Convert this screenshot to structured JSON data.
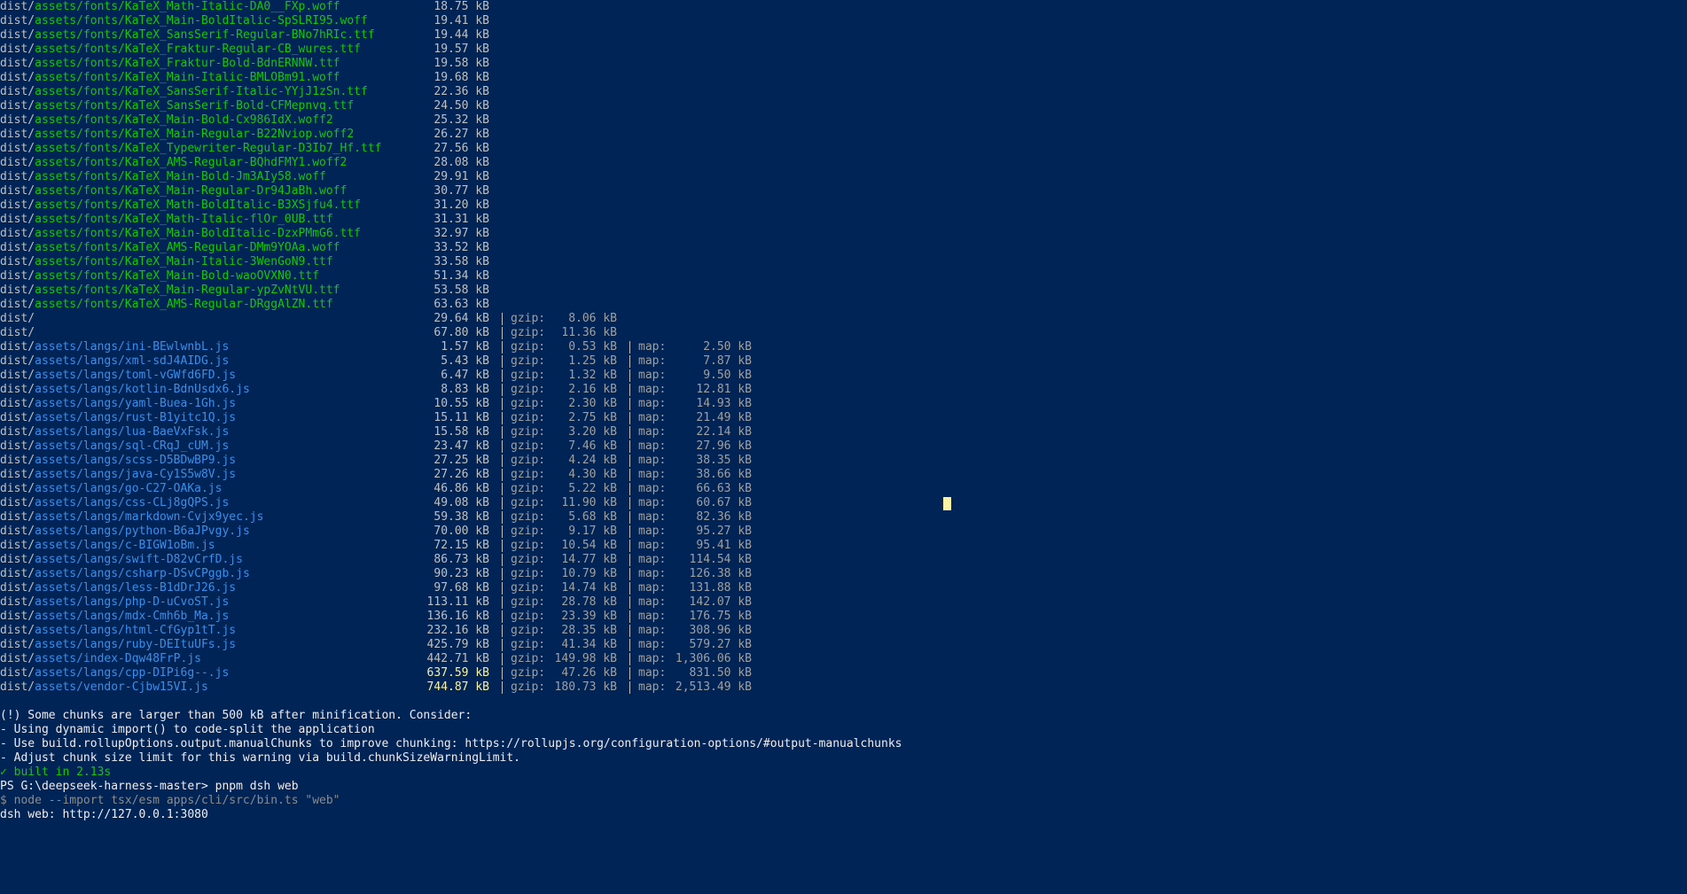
{
  "terminal": {
    "background": "#012456",
    "colors": {
      "font_asset": "#16c60c",
      "lang_asset": "#3b8eea",
      "text": "#c0c0c0",
      "large_chunk": "#f9f1a5",
      "success": "#16c60c",
      "cursor": "#f9f1a5"
    },
    "font_rows": [
      {
        "prefix": "dist/",
        "path": "assets/fonts/KaTeX_Math-Italic-DA0__FXp.woff",
        "size": "18.75 kB"
      },
      {
        "prefix": "dist/",
        "path": "assets/fonts/KaTeX_Main-BoldItalic-SpSLRI95.woff",
        "size": "19.41 kB"
      },
      {
        "prefix": "dist/",
        "path": "assets/fonts/KaTeX_SansSerif-Regular-BNo7hRIc.ttf",
        "size": "19.44 kB"
      },
      {
        "prefix": "dist/",
        "path": "assets/fonts/KaTeX_Fraktur-Regular-CB_wures.ttf",
        "size": "19.57 kB"
      },
      {
        "prefix": "dist/",
        "path": "assets/fonts/KaTeX_Fraktur-Bold-BdnERNNW.ttf",
        "size": "19.58 kB"
      },
      {
        "prefix": "dist/",
        "path": "assets/fonts/KaTeX_Main-Italic-BMLOBm91.woff",
        "size": "19.68 kB"
      },
      {
        "prefix": "dist/",
        "path": "assets/fonts/KaTeX_SansSerif-Italic-YYjJ1zSn.ttf",
        "size": "22.36 kB"
      },
      {
        "prefix": "dist/",
        "path": "assets/fonts/KaTeX_SansSerif-Bold-CFMepnvq.ttf",
        "size": "24.50 kB"
      },
      {
        "prefix": "dist/",
        "path": "assets/fonts/KaTeX_Main-Bold-Cx986IdX.woff2",
        "size": "25.32 kB"
      },
      {
        "prefix": "dist/",
        "path": "assets/fonts/KaTeX_Main-Regular-B22Nviop.woff2",
        "size": "26.27 kB"
      },
      {
        "prefix": "dist/",
        "path": "assets/fonts/KaTeX_Typewriter-Regular-D3Ib7_Hf.ttf",
        "size": "27.56 kB"
      },
      {
        "prefix": "dist/",
        "path": "assets/fonts/KaTeX_AMS-Regular-BQhdFMY1.woff2",
        "size": "28.08 kB"
      },
      {
        "prefix": "dist/",
        "path": "assets/fonts/KaTeX_Main-Bold-Jm3AIy58.woff",
        "size": "29.91 kB"
      },
      {
        "prefix": "dist/",
        "path": "assets/fonts/KaTeX_Main-Regular-Dr94JaBh.woff",
        "size": "30.77 kB"
      },
      {
        "prefix": "dist/",
        "path": "assets/fonts/KaTeX_Math-BoldItalic-B3XSjfu4.ttf",
        "size": "31.20 kB"
      },
      {
        "prefix": "dist/",
        "path": "assets/fonts/KaTeX_Math-Italic-flOr_0UB.ttf",
        "size": "31.31 kB"
      },
      {
        "prefix": "dist/",
        "path": "assets/fonts/KaTeX_Main-BoldItalic-DzxPMmG6.ttf",
        "size": "32.97 kB"
      },
      {
        "prefix": "dist/",
        "path": "assets/fonts/KaTeX_AMS-Regular-DMm9YOAa.woff",
        "size": "33.52 kB"
      },
      {
        "prefix": "dist/",
        "path": "assets/fonts/KaTeX_Main-Italic-3WenGoN9.ttf",
        "size": "33.58 kB"
      },
      {
        "prefix": "dist/",
        "path": "assets/fonts/KaTeX_Main-Bold-waoOVXN0.ttf",
        "size": "51.34 kB"
      },
      {
        "prefix": "dist/",
        "path": "assets/fonts/KaTeX_Main-Regular-ypZvNtVU.ttf",
        "size": "53.58 kB"
      },
      {
        "prefix": "dist/",
        "path": "assets/fonts/KaTeX_AMS-Regular-DRggAlZN.ttf",
        "size": "63.63 kB"
      }
    ],
    "dist_rows": [
      {
        "path": "dist/",
        "size": "29.64 kB",
        "gzip_label": "gzip:",
        "gzip": "8.06 kB"
      },
      {
        "path": "dist/",
        "size": "67.80 kB",
        "gzip_label": "gzip:",
        "gzip": "11.36 kB"
      }
    ],
    "lang_rows": [
      {
        "prefix": "dist/",
        "path": "assets/langs/ini-BEwlwnbL.js",
        "size": "1.57 kB",
        "gzip": "0.53 kB",
        "map": "2.50 kB"
      },
      {
        "prefix": "dist/",
        "path": "assets/langs/xml-sdJ4AIDG.js",
        "size": "5.43 kB",
        "gzip": "1.25 kB",
        "map": "7.87 kB"
      },
      {
        "prefix": "dist/",
        "path": "assets/langs/toml-vGWfd6FD.js",
        "size": "6.47 kB",
        "gzip": "1.32 kB",
        "map": "9.50 kB"
      },
      {
        "prefix": "dist/",
        "path": "assets/langs/kotlin-BdnUsdx6.js",
        "size": "8.83 kB",
        "gzip": "2.16 kB",
        "map": "12.81 kB"
      },
      {
        "prefix": "dist/",
        "path": "assets/langs/yaml-Buea-1Gh.js",
        "size": "10.55 kB",
        "gzip": "2.30 kB",
        "map": "14.93 kB"
      },
      {
        "prefix": "dist/",
        "path": "assets/langs/rust-B1yitc1Q.js",
        "size": "15.11 kB",
        "gzip": "2.75 kB",
        "map": "21.49 kB"
      },
      {
        "prefix": "dist/",
        "path": "assets/langs/lua-BaeVxFsk.js",
        "size": "15.58 kB",
        "gzip": "3.20 kB",
        "map": "22.14 kB"
      },
      {
        "prefix": "dist/",
        "path": "assets/langs/sql-CRqJ_cUM.js",
        "size": "23.47 kB",
        "gzip": "7.46 kB",
        "map": "27.96 kB"
      },
      {
        "prefix": "dist/",
        "path": "assets/langs/scss-D5BDwBP9.js",
        "size": "27.25 kB",
        "gzip": "4.24 kB",
        "map": "38.35 kB"
      },
      {
        "prefix": "dist/",
        "path": "assets/langs/java-Cy1S5w8V.js",
        "size": "27.26 kB",
        "gzip": "4.30 kB",
        "map": "38.66 kB"
      },
      {
        "prefix": "dist/",
        "path": "assets/langs/go-C27-OAKa.js",
        "size": "46.86 kB",
        "gzip": "5.22 kB",
        "map": "66.63 kB"
      },
      {
        "prefix": "dist/",
        "path": "assets/langs/css-CLj8gQPS.js",
        "size": "49.08 kB",
        "gzip": "11.90 kB",
        "map": "60.67 kB"
      },
      {
        "prefix": "dist/",
        "path": "assets/langs/markdown-Cvjx9yec.js",
        "size": "59.38 kB",
        "gzip": "5.68 kB",
        "map": "82.36 kB"
      },
      {
        "prefix": "dist/",
        "path": "assets/langs/python-B6aJPvgy.js",
        "size": "70.00 kB",
        "gzip": "9.17 kB",
        "map": "95.27 kB"
      },
      {
        "prefix": "dist/",
        "path": "assets/langs/c-BIGW1oBm.js",
        "size": "72.15 kB",
        "gzip": "10.54 kB",
        "map": "95.41 kB"
      },
      {
        "prefix": "dist/",
        "path": "assets/langs/swift-D82vCrfD.js",
        "size": "86.73 kB",
        "gzip": "14.77 kB",
        "map": "114.54 kB"
      },
      {
        "prefix": "dist/",
        "path": "assets/langs/csharp-DSvCPggb.js",
        "size": "90.23 kB",
        "gzip": "10.79 kB",
        "map": "126.38 kB"
      },
      {
        "prefix": "dist/",
        "path": "assets/langs/less-B1dDrJ26.js",
        "size": "97.68 kB",
        "gzip": "14.74 kB",
        "map": "131.88 kB"
      },
      {
        "prefix": "dist/",
        "path": "assets/langs/php-D-uCvoST.js",
        "size": "113.11 kB",
        "gzip": "28.78 kB",
        "map": "142.07 kB"
      },
      {
        "prefix": "dist/",
        "path": "assets/langs/mdx-Cmh6b_Ma.js",
        "size": "136.16 kB",
        "gzip": "23.39 kB",
        "map": "176.75 kB"
      },
      {
        "prefix": "dist/",
        "path": "assets/langs/html-CfGyp1tT.js",
        "size": "232.16 kB",
        "gzip": "28.35 kB",
        "map": "308.96 kB"
      },
      {
        "prefix": "dist/",
        "path": "assets/langs/ruby-DEItuUFs.js",
        "size": "425.79 kB",
        "gzip": "41.34 kB",
        "map": "579.27 kB"
      },
      {
        "prefix": "dist/",
        "path": "assets/index-Dqw48FrP.js",
        "size": "442.71 kB",
        "gzip": "149.98 kB",
        "map": "1,306.06 kB"
      },
      {
        "prefix": "dist/",
        "path": "assets/langs/cpp-DIPi6g--.js",
        "size": "637.59 kB",
        "gzip": "47.26 kB",
        "map": "831.50 kB",
        "large": true
      },
      {
        "prefix": "dist/",
        "path": "assets/vendor-Cjbw15VI.js",
        "size": "744.87 kB",
        "gzip": "180.73 kB",
        "map": "2,513.49 kB",
        "large": true
      }
    ],
    "gzip_label": "gzip:",
    "map_label": "map:",
    "warning_lines": [
      "(!) Some chunks are larger than 500 kB after minification. Consider:",
      "- Using dynamic import() to code-split the application",
      "- Use build.rollupOptions.output.manualChunks to improve chunking: https://rollupjs.org/configuration-options/#output-manualchunks",
      "- Adjust chunk size limit for this warning via build.chunkSizeWarningLimit."
    ],
    "built_line": "✓ built in 2.13s",
    "prompt_line": "PS G:\\deepseek-harness-master> pnpm dsh web",
    "command_echo": "$ node --import tsx/esm apps/cli/src/bin.ts \"web\"",
    "server_line": "dsh web: http://127.0.0.1:3080"
  }
}
